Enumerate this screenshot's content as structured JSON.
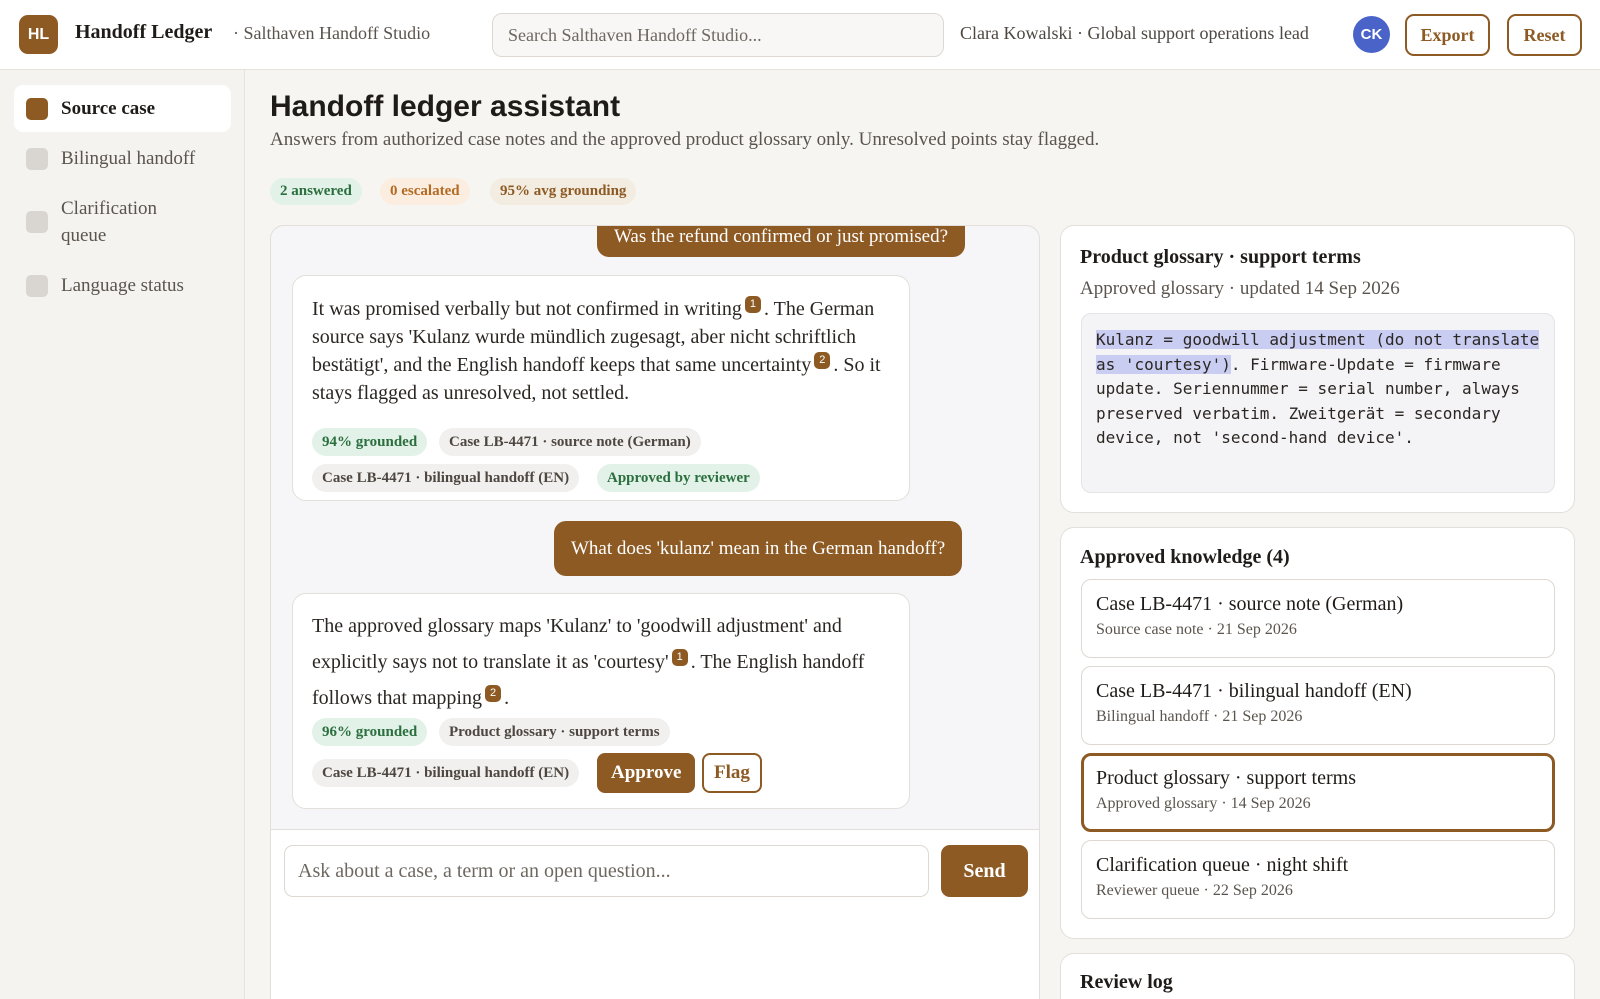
{
  "header": {
    "logo_text": "HL",
    "app_name": "Handoff Ledger",
    "workspace": "· Salthaven Handoff Studio",
    "search_placeholder": "Search Salthaven Handoff Studio...",
    "user_line": "Clara Kowalski · Global support operations lead",
    "avatar_initials": "CK",
    "export_label": "Export",
    "reset_label": "Reset"
  },
  "sidebar": {
    "items": [
      {
        "label": "Source case",
        "active": true
      },
      {
        "label": "Bilingual handoff",
        "active": false
      },
      {
        "label": "Clarification queue",
        "active": false
      },
      {
        "label": "Language status",
        "active": false
      }
    ]
  },
  "main": {
    "title": "Handoff ledger assistant",
    "subtitle": "Answers from authorized case notes and the approved product glossary only. Unresolved points stay flagged.",
    "stats": {
      "answered": "2 answered",
      "escalated": "0 escalated",
      "grounding": "95% avg grounding"
    }
  },
  "chat": {
    "q1": "Was the refund confirmed or just promised?",
    "a1": {
      "part1": "It was promised verbally but not confirmed in writing",
      "cite1": "1",
      "part2": ". The German source says 'Kulanz wurde mündlich zugesagt, aber nicht schriftlich bestätigt', and the English handoff keeps that same uncertainty",
      "cite2": "2",
      "part3": ". So it stays flagged as unresolved, not settled.",
      "grounded": "94% grounded",
      "source1": "Case LB-4471 · source note (German)",
      "source2": "Case LB-4471 · bilingual handoff (EN)",
      "status": "Approved by reviewer"
    },
    "q2": "What does 'kulanz' mean in the German handoff?",
    "a2": {
      "part1": "The approved glossary maps 'Kulanz' to 'goodwill adjustment' and explicitly says not to translate it as 'courtesy'",
      "cite1": "1",
      "part2": ". The English handoff follows that mapping",
      "cite2": "2",
      "part3": ".",
      "grounded": "96% grounded",
      "source1": "Product glossary · support terms",
      "source2": "Case LB-4471 · bilingual handoff (EN)",
      "approve_label": "Approve",
      "flag_label": "Flag"
    },
    "composer_placeholder": "Ask about a case, a term or an open question...",
    "send_label": "Send"
  },
  "glossary": {
    "title": "Product glossary · support terms",
    "subtitle": "Approved glossary · updated 14 Sep 2026",
    "highlighted": "Kulanz = goodwill adjustment (do not translate as 'courtesy')",
    "rest": ". Firmware-Update = firmware update. Seriennummer = serial number, always preserved verbatim. Zweitgerät = secondary device, not 'second-hand device'."
  },
  "knowledge": {
    "title": "Approved knowledge (4)",
    "items": [
      {
        "title": "Case LB-4471 · source note (German)",
        "meta": "Source case note · 21 Sep 2026",
        "selected": false
      },
      {
        "title": "Case LB-4471 · bilingual handoff (EN)",
        "meta": "Bilingual handoff · 21 Sep 2026",
        "selected": false
      },
      {
        "title": "Product glossary · support terms",
        "meta": "Approved glossary · 14 Sep 2026",
        "selected": true
      },
      {
        "title": "Clarification queue · night shift",
        "meta": "Reviewer queue · 22 Sep 2026",
        "selected": false
      }
    ]
  },
  "review_log": {
    "title": "Review log"
  },
  "colors": {
    "accent": "#8d5a24",
    "avatar": "#4a63c9",
    "grounded_green": "#2b6f3f",
    "escalated_orange": "#b36a23"
  }
}
